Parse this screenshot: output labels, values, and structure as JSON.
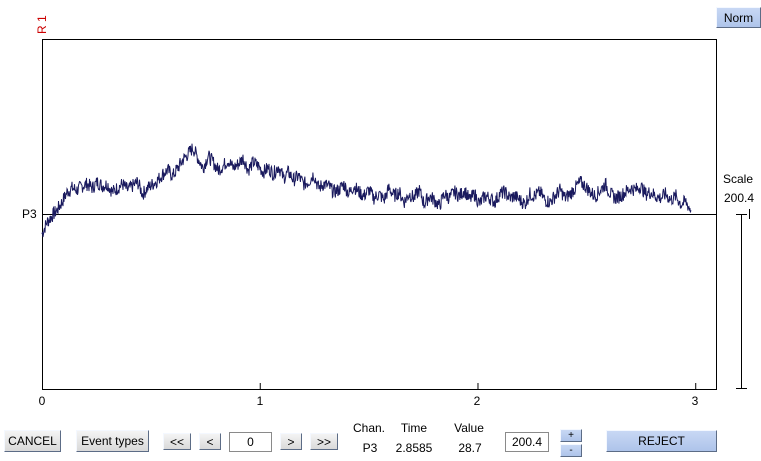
{
  "header": {
    "record_label": "R 1",
    "norm_button": "Norm"
  },
  "chart_data": {
    "type": "line",
    "channel_label": "P3",
    "xlim": [
      0,
      3.1
    ],
    "x_ticks": [
      "0",
      "1",
      "2",
      "3"
    ],
    "signal_end_time": 2.98,
    "scale_label": "Scale",
    "scale_value": "200.4",
    "series": [
      {
        "color": "#1a1a5e",
        "samples": [
          -20,
          -8,
          -2,
          4,
          12,
          22,
          26,
          24,
          28,
          30,
          26,
          32,
          28,
          30,
          22,
          26,
          30,
          24,
          28,
          32,
          20,
          26,
          30,
          34,
          40,
          44,
          38,
          46,
          54,
          60,
          66,
          56,
          46,
          58,
          52,
          44,
          48,
          54,
          46,
          50,
          56,
          44,
          52,
          48,
          42,
          46,
          40,
          48,
          36,
          42,
          34,
          38,
          30,
          32,
          40,
          26,
          30,
          28,
          22,
          24,
          30,
          20,
          28,
          22,
          18,
          24,
          16,
          20,
          14,
          26,
          18,
          22,
          12,
          20,
          16,
          24,
          10,
          18,
          14,
          8,
          20,
          16,
          22,
          18,
          24,
          14,
          20,
          10,
          18,
          16,
          12,
          20,
          22,
          16,
          18,
          14,
          10,
          20,
          18,
          22,
          14,
          12,
          18,
          24,
          16,
          20,
          26,
          32,
          28,
          22,
          18,
          24,
          30,
          20,
          16,
          18,
          22,
          26,
          24,
          28,
          20,
          22,
          18,
          16,
          20,
          14,
          18,
          10,
          12,
          4
        ]
      }
    ]
  },
  "toolbar": {
    "cancel": "CANCEL",
    "event_types": "Event types",
    "first": "<<",
    "prev": "<",
    "page_value": "0",
    "next": ">",
    "last": ">>",
    "reject": "REJECT",
    "scale_input": "200.4",
    "scale_up": "+",
    "scale_down": "-"
  },
  "readout": {
    "chan_header": "Chan.",
    "time_header": "Time",
    "value_header": "Value",
    "chan": "P3",
    "time": "2.8585",
    "value": "28.7"
  }
}
